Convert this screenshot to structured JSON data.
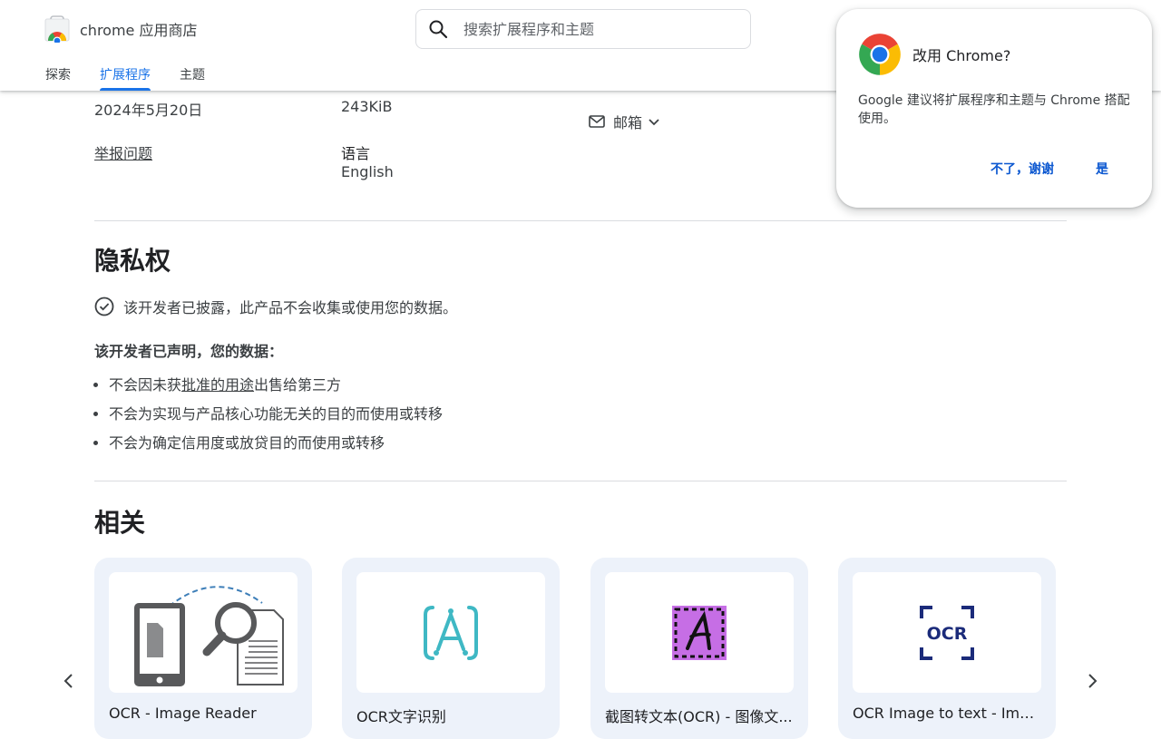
{
  "header": {
    "app_title": "chrome 应用商店",
    "search": {
      "placeholder": "搜索扩展程序和主题",
      "value": ""
    },
    "tabs": [
      {
        "label": "探索",
        "active": false
      },
      {
        "label": "扩展程序",
        "active": true
      },
      {
        "label": "主题",
        "active": false
      }
    ],
    "accent_color": "#1a73e8"
  },
  "details": {
    "updated_value": "2024年5月20日",
    "size_value": "243KiB",
    "report_link": "举报问题",
    "language_label": "语言",
    "language_value": "English",
    "email_label": "邮箱"
  },
  "privacy": {
    "heading": "隐私权",
    "disclosure": "该开发者已披露，此产品不会收集或使用您的数据。",
    "declared": "该开发者已声明，您的数据：",
    "items": [
      {
        "before": "不会因未获",
        "link": "批准的用途",
        "after": "出售给第三方"
      },
      {
        "text": "不会为实现与产品核心功能无关的目的而使用或转移"
      },
      {
        "text": "不会为确定信用度或放贷目的而使用或转移"
      }
    ]
  },
  "related": {
    "heading": "相关",
    "cards": [
      {
        "title": "OCR - Image Reader",
        "icon": "ocr-image-reader-icon"
      },
      {
        "title": "OCR文字识别",
        "icon": "ocr-text-recognition-icon"
      },
      {
        "title": "截图转文本(OCR) - 图像文...",
        "icon": "screenshot-to-text-icon"
      },
      {
        "title": "OCR Image to text - Imag...",
        "icon": "ocr-image-to-text-icon"
      }
    ]
  },
  "popup": {
    "title": "改用 Chrome?",
    "body": "Google 建议将扩展程序和主题与 Chrome 搭配使用。",
    "decline": "不了，谢谢",
    "accept": "是"
  }
}
